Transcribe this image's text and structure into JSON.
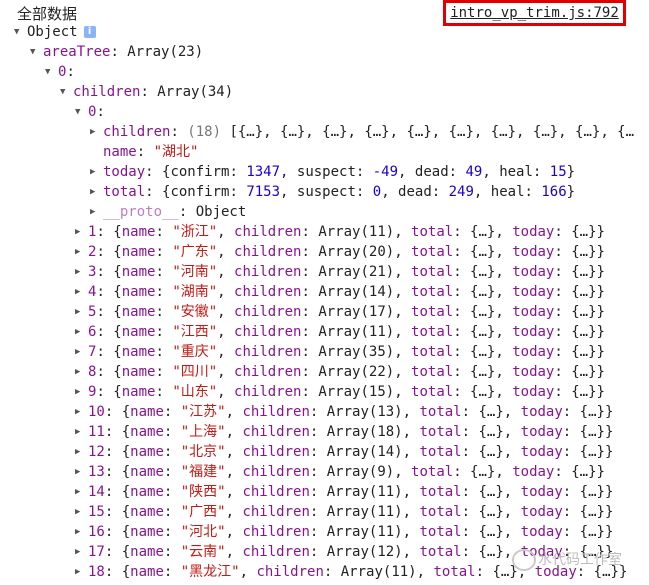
{
  "log_label": "全部数据",
  "source_link": "intro_vp_trim.js:792",
  "root": {
    "name": "Object",
    "info_badge": "i"
  },
  "areaTree": {
    "key": "areaTree",
    "summary": "Array(23)"
  },
  "country_index": "0",
  "children_row": {
    "key": "children",
    "summary": "Array(34)"
  },
  "hubei": {
    "index": "0",
    "children_key": "children",
    "children_count": "(18)",
    "children_preview": "[{…}, {…}, {…}, {…}, {…}, {…}, {…}, {…}, {…}, {…",
    "name_key": "name",
    "name_value": "\"湖北\"",
    "today": {
      "key": "today",
      "confirm": "1347",
      "suspect": "-49",
      "dead": "49",
      "heal": "15"
    },
    "total": {
      "key": "total",
      "confirm": "7153",
      "suspect": "0",
      "dead": "249",
      "heal": "166"
    },
    "proto_key": "__proto__",
    "proto_value": "Object"
  },
  "provinces": [
    {
      "idx": "1",
      "name": "\"浙江\"",
      "children": "Array(11)"
    },
    {
      "idx": "2",
      "name": "\"广东\"",
      "children": "Array(20)"
    },
    {
      "idx": "3",
      "name": "\"河南\"",
      "children": "Array(21)"
    },
    {
      "idx": "4",
      "name": "\"湖南\"",
      "children": "Array(14)"
    },
    {
      "idx": "5",
      "name": "\"安徽\"",
      "children": "Array(17)"
    },
    {
      "idx": "6",
      "name": "\"江西\"",
      "children": "Array(11)"
    },
    {
      "idx": "7",
      "name": "\"重庆\"",
      "children": "Array(35)"
    },
    {
      "idx": "8",
      "name": "\"四川\"",
      "children": "Array(22)"
    },
    {
      "idx": "9",
      "name": "\"山东\"",
      "children": "Array(15)"
    },
    {
      "idx": "10",
      "name": "\"江苏\"",
      "children": "Array(13)"
    },
    {
      "idx": "11",
      "name": "\"上海\"",
      "children": "Array(18)"
    },
    {
      "idx": "12",
      "name": "\"北京\"",
      "children": "Array(14)"
    },
    {
      "idx": "13",
      "name": "\"福建\"",
      "children": "Array(9)"
    },
    {
      "idx": "14",
      "name": "\"陕西\"",
      "children": "Array(11)"
    },
    {
      "idx": "15",
      "name": "\"广西\"",
      "children": "Array(11)"
    },
    {
      "idx": "16",
      "name": "\"河北\"",
      "children": "Array(11)"
    },
    {
      "idx": "17",
      "name": "\"云南\"",
      "children": "Array(12)"
    },
    {
      "idx": "18",
      "name": "\"黑龙江\"",
      "children": "Array(11)"
    }
  ],
  "watermark": "水代码工作室",
  "colors": {
    "highlight_box": "#e00000",
    "key": "#881391",
    "string": "#c41a16",
    "number": "#1c00cf"
  }
}
